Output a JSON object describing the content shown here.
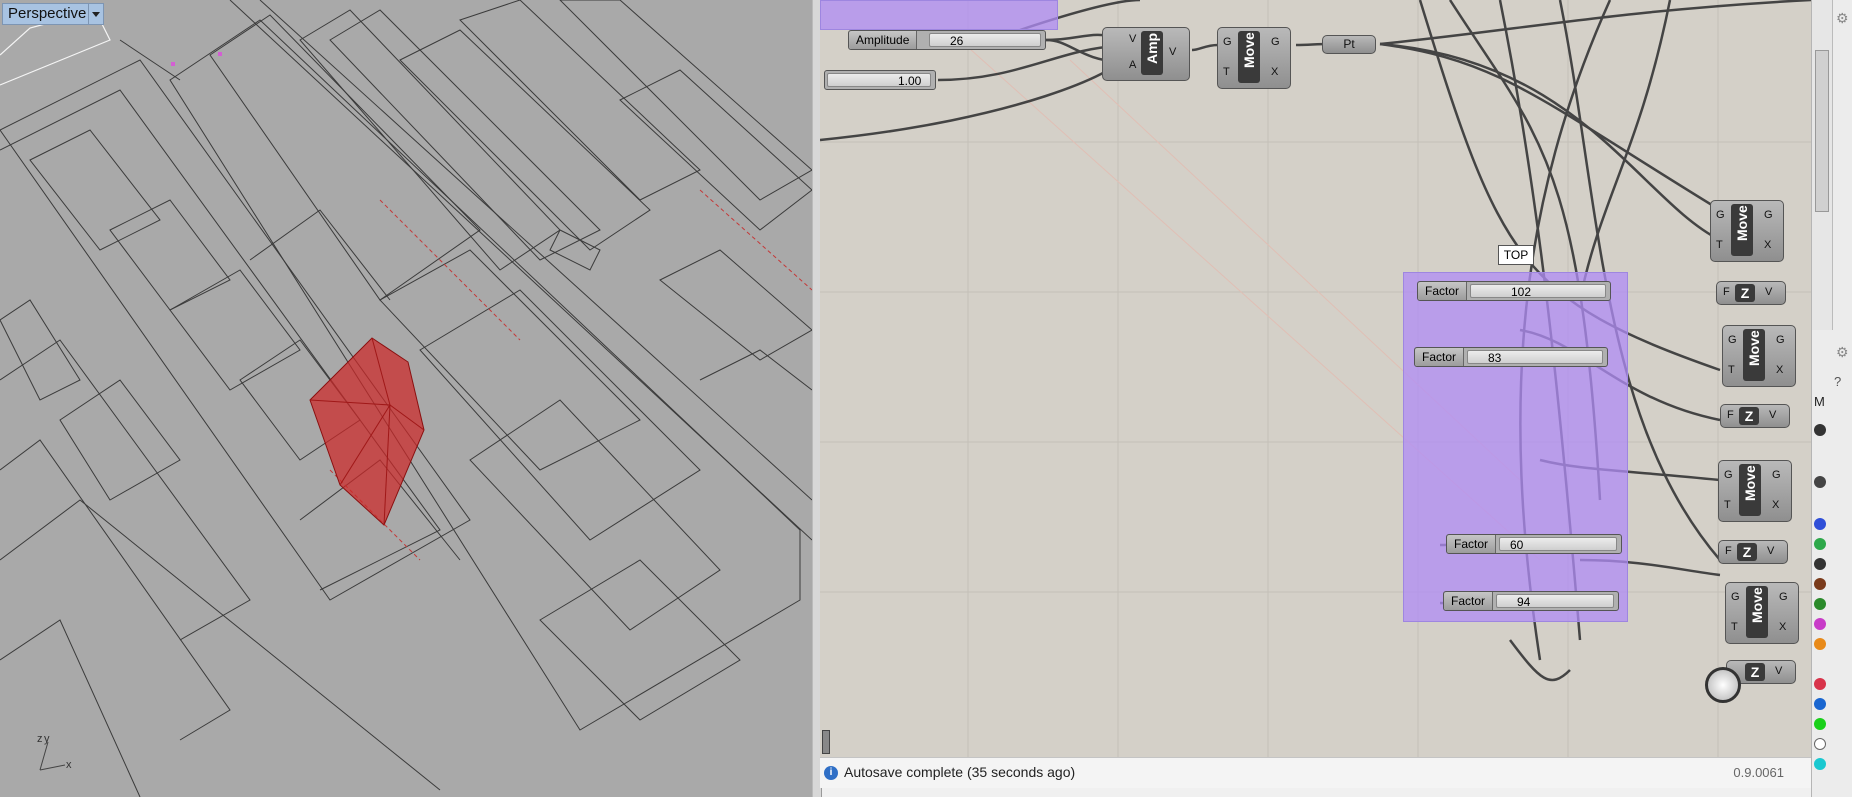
{
  "viewport": {
    "label": "Perspective",
    "axis_z": "z",
    "axis_y": "y",
    "axis_x": "x",
    "object_color": "#c83232"
  },
  "canvas": {
    "sliders": [
      {
        "label": "Amplitude",
        "value": "26"
      },
      {
        "label": "",
        "value": "1.00"
      },
      {
        "label": "Factor",
        "value": "102"
      },
      {
        "label": "Factor",
        "value": "83"
      },
      {
        "label": "Factor",
        "value": "60"
      },
      {
        "label": "Factor",
        "value": "94"
      }
    ],
    "amp": {
      "title": "Amp",
      "in1": "V",
      "in2": "A",
      "out": "V"
    },
    "move": {
      "title": "Move",
      "in1": "G",
      "in2": "T",
      "out1": "G",
      "out2": "X"
    },
    "pt": "Pt",
    "z": {
      "f": "F",
      "title": "Z",
      "v": "V"
    },
    "tooltip": "TOP",
    "group_color": "#b08cf6"
  },
  "status": {
    "message": "Autosave complete (35 seconds ago)",
    "version": "0.9.0061",
    "icon": "info-icon"
  },
  "rightbar": {
    "label": "M"
  }
}
